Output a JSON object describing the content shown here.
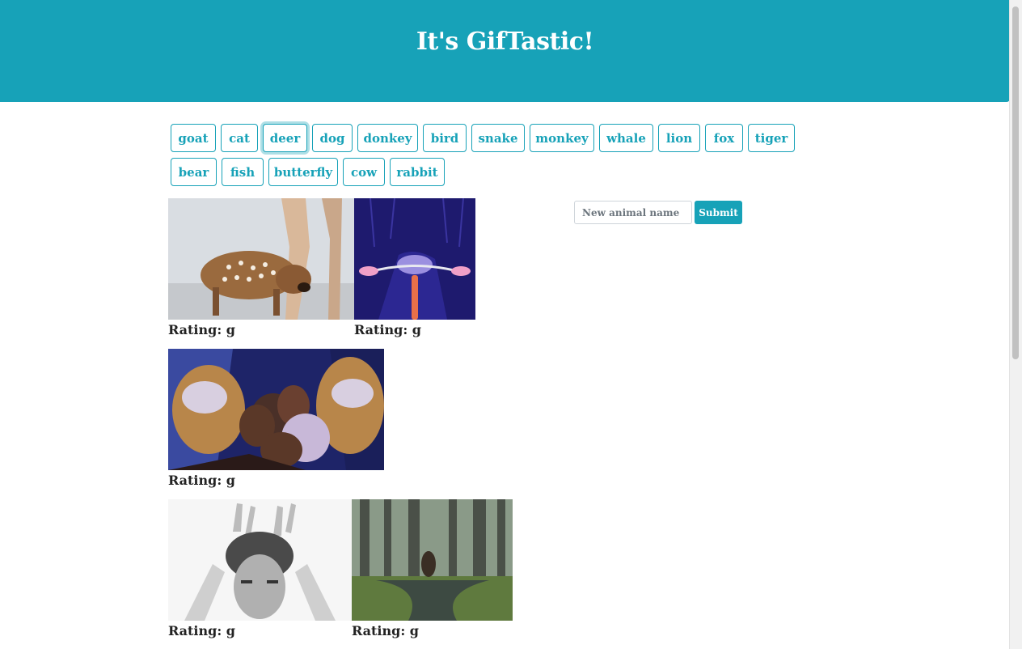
{
  "header": {
    "title": "It's GifTastic!"
  },
  "animals": [
    "goat",
    "cat",
    "deer",
    "dog",
    "donkey",
    "bird",
    "snake",
    "monkey",
    "whale",
    "lion",
    "fox",
    "tiger",
    "bear",
    "fish",
    "butterfly",
    "cow",
    "rabbit"
  ],
  "form": {
    "placeholder": "New animal name",
    "submit_label": "Submit"
  },
  "gifs": [
    {
      "rating_label": "Rating: g"
    },
    {
      "rating_label": "Rating: g"
    },
    {
      "rating_label": "Rating: g"
    },
    {
      "rating_label": "Rating: g"
    },
    {
      "rating_label": "Rating: g"
    }
  ],
  "colors": {
    "accent": "#17a2b8"
  }
}
